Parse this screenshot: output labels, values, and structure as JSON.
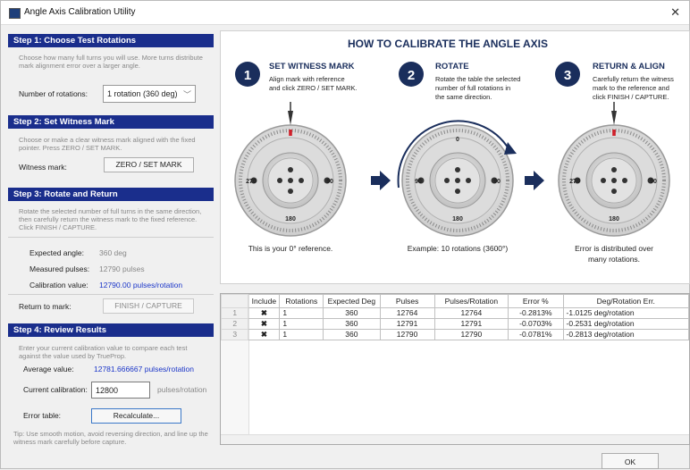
{
  "window": {
    "title": "Angle Axis Calibration Utility",
    "close_glyph": "✕"
  },
  "step1": {
    "heading": "Step 1: Choose Test Rotations",
    "desc": "Choose how many full turns you will use. More turns distribute mark alignment error over a larger angle.",
    "rotations_label": "Number of rotations:",
    "rotations_value": "1 rotation (360 deg)"
  },
  "step2": {
    "heading": "Step 2: Set Witness Mark",
    "desc": "Choose or make a clear witness mark aligned with the fixed pointer. Press ZERO / SET MARK.",
    "witness_label": "Witness mark:",
    "zero_button": "ZERO / SET MARK"
  },
  "step3": {
    "heading": "Step 3: Rotate and Return",
    "desc": "Rotate the selected number of full turns in the same direction, then carefully return the witness mark to the fixed reference. Click FINISH / CAPTURE.",
    "expected_label": "Expected angle:",
    "expected_value": "360 deg",
    "pulses_label": "Measured pulses:",
    "pulses_value": "12790 pulses",
    "cal_label": "Calibration value:",
    "cal_value": "12790.00 pulses/rotation",
    "return_label": "Return to mark:",
    "finish_button": "FINISH / CAPTURE"
  },
  "step4": {
    "heading": "Step 4: Review Results",
    "desc": "Enter your current calibration value to compare each test against the value used by TrueProp.",
    "avg_label": "Average value:",
    "avg_value": "12781.666667 pulses/rotation",
    "current_label": "Current calibration:",
    "current_value": "12800",
    "current_unit": "pulses/rotation",
    "error_label": "Error table:",
    "recalc_button": "Recalculate...",
    "tip": "Tip: Use smooth motion, avoid reversing direction, and line up the witness mark carefully before capture."
  },
  "howto": {
    "title": "HOW TO CALIBRATE THE ANGLE AXIS",
    "steps": [
      {
        "num": "1",
        "title": "SET WITNESS MARK",
        "lines": [
          "Align mark with reference",
          "and click ZERO / SET MARK."
        ],
        "caption": [
          "This is your 0° reference."
        ]
      },
      {
        "num": "2",
        "title": "ROTATE",
        "lines": [
          "Rotate the table the selected",
          "number of full rotations in",
          "the same direction."
        ],
        "caption": [
          "Example: 10 rotations (3600°)"
        ]
      },
      {
        "num": "3",
        "title": "RETURN & ALIGN",
        "lines": [
          "Carefully return the witness",
          "mark to the reference and",
          "click FINISH / CAPTURE."
        ],
        "caption": [
          "Error is distributed over",
          "many rotations."
        ]
      }
    ],
    "dial_labels": {
      "top": "0",
      "left": "270",
      "right": "90",
      "bottom": "180"
    }
  },
  "table": {
    "columns": [
      "Include",
      "Rotations",
      "Expected Deg",
      "Pulses",
      "Pulses/Rotation",
      "Error %",
      "Deg/Rotation Err."
    ],
    "rows": [
      {
        "idx": "1",
        "include": "✖",
        "rotations": "1",
        "expected": "360",
        "pulses": "12764",
        "ppr": "12764",
        "err": "-0.2813%",
        "deg_err": "-1.0125 deg/rotation"
      },
      {
        "idx": "2",
        "include": "✖",
        "rotations": "1",
        "expected": "360",
        "pulses": "12791",
        "ppr": "12791",
        "err": "-0.0703%",
        "deg_err": "-0.2531 deg/rotation"
      },
      {
        "idx": "3",
        "include": "✖",
        "rotations": "1",
        "expected": "360",
        "pulses": "12790",
        "ppr": "12790",
        "err": "-0.0781%",
        "deg_err": "-0.2813 deg/rotation"
      }
    ]
  },
  "footer": {
    "ok_button": "OK"
  },
  "colors": {
    "accent": "#1a2e8c",
    "link_blue": "#1a35c8",
    "pointer_red": "#d0202a"
  }
}
